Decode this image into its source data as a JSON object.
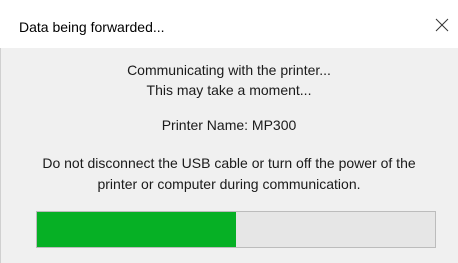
{
  "window": {
    "title": "Data being forwarded...",
    "close_icon": "close-icon"
  },
  "dialog": {
    "status_line1": "Communicating with the printer...",
    "status_line2": "This may take a moment...",
    "printer_name": "Printer Name: MP300",
    "warning_line1": "Do not disconnect the USB cable or turn off the power of the",
    "warning_line2": "printer or computer during communication."
  },
  "progress": {
    "fraction": 0.5,
    "fill_color": "#06b025",
    "track_color": "#e6e6e6"
  }
}
